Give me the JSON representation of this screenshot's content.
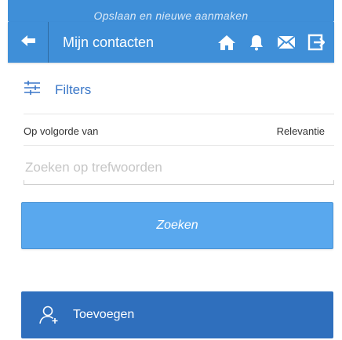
{
  "top_notice": {
    "text": "Opslaan en nieuwe aanmaken"
  },
  "app_bar": {
    "title": "Mijn contacten",
    "icons": [
      "arrow-left-icon",
      "home-icon",
      "bell-icon",
      "mail-icon",
      "exit-icon"
    ]
  },
  "filters": {
    "label": "Filters",
    "icon": "filter-sliders-icon"
  },
  "sort": {
    "label": "Op volgorde van",
    "value": "Relevantie"
  },
  "search": {
    "placeholder": "Zoeken op trefwoorden",
    "value": ""
  },
  "buttons": {
    "search_label": "Zoeken",
    "add_label": "Toevoegen",
    "add_icon": "user-add-icon"
  },
  "colors": {
    "header": "#3f8fd8",
    "search_button": "#59a8ee",
    "add_button": "#2f6fbd",
    "link": "#3a77c8"
  }
}
